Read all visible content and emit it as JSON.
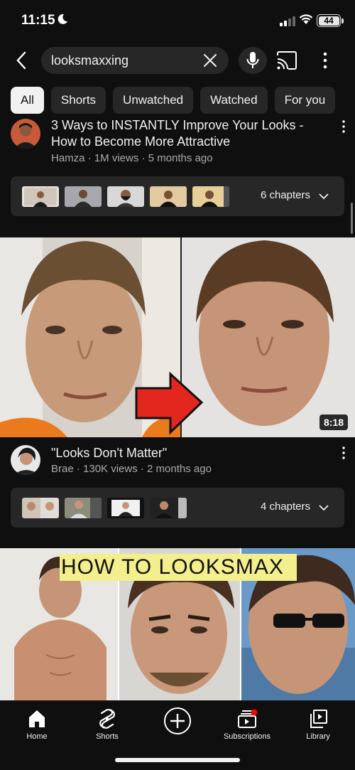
{
  "status": {
    "time": "11:15",
    "battery": "44"
  },
  "search": {
    "query": "looksmaxxing"
  },
  "chips": [
    "All",
    "Shorts",
    "Unwatched",
    "Watched",
    "For you"
  ],
  "videos": [
    {
      "title_line1": "3 Ways to INSTANTLY Improve Your Looks -",
      "title_line2": "How to Become More Attractive",
      "meta": "Hamza · 1M views · 5 months ago",
      "chapters": "6 chapters"
    },
    {
      "title": "\"Looks Don't Matter\"",
      "meta": "Brae · 130K views · 2 months ago",
      "duration": "8:18",
      "chapters": "4 chapters"
    },
    {
      "thumbnail_text": "HOW TO LOOKSMAX"
    }
  ],
  "nav": {
    "home": "Home",
    "shorts": "Shorts",
    "subscriptions": "Subscriptions",
    "library": "Library"
  },
  "colors": {
    "background": "#0f0f0f",
    "chip": "#272727",
    "accent_red": "#ff0000"
  }
}
